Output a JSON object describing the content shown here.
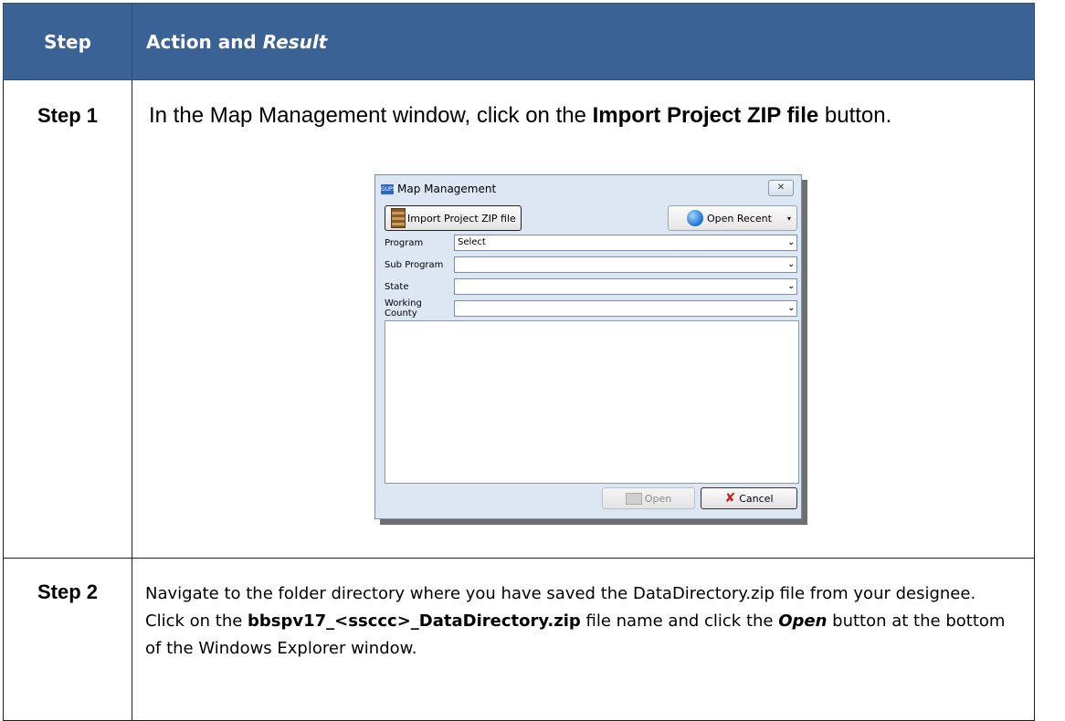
{
  "table": {
    "header_step": "Step",
    "header_action": "Action and ",
    "header_result": "Result",
    "rows": [
      {
        "step": "Step 1",
        "text_1": "In the Map Management window, click on the ",
        "text_bold": "Import Project ZIP file",
        "text_2": " button."
      },
      {
        "step": "Step 2",
        "text_1": "Navigate to the folder directory where you have saved the DataDirectory.zip file from your designee. Click on the ",
        "text_bold": "bbspv17_<ssccc>_DataDirectory.zip",
        "text_2": " file name and click the ",
        "text_bold_italic": "Open",
        "text_3": " button at the bottom of the Windows Explorer window."
      }
    ]
  },
  "dialog": {
    "app_icon_text": "GUPS",
    "title": "Map Management",
    "close_glyph": "✕",
    "import_button": "Import Project ZIP file",
    "open_recent_button": "Open Recent",
    "dropdown_glyph": "▾",
    "chevron_glyph": "⌄",
    "fields": [
      {
        "label": "Program",
        "value": "Select"
      },
      {
        "label": "Sub Program",
        "value": ""
      },
      {
        "label": "State",
        "value": ""
      },
      {
        "label": "Working County",
        "value": ""
      }
    ],
    "open_button": "Open",
    "cancel_button": "Cancel",
    "cancel_glyph": "✘"
  }
}
